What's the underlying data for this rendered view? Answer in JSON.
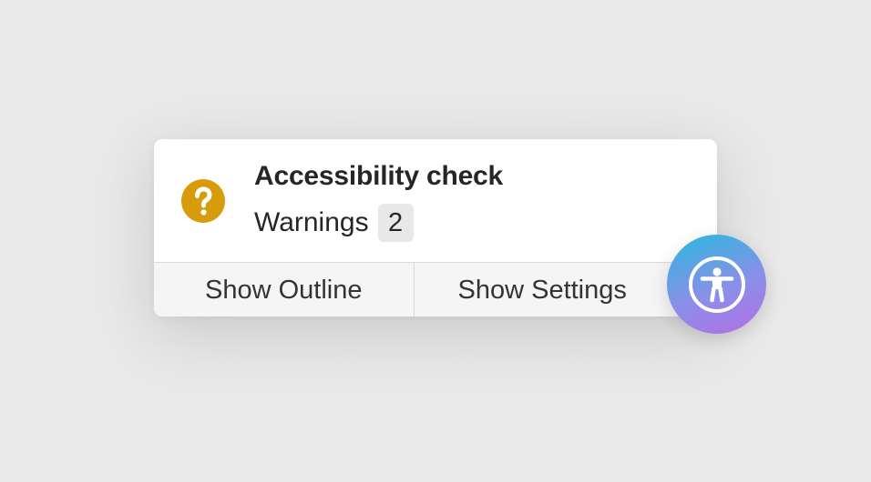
{
  "popover": {
    "icon": "question-mark-icon",
    "title": "Accessibility check",
    "warnings_label": "Warnings",
    "warnings_count": "2",
    "actions": {
      "show_outline": "Show Outline",
      "show_settings": "Show Settings"
    }
  },
  "badge": {
    "icon": "accessibility-icon"
  },
  "colors": {
    "background": "#e9e9ea",
    "warning": "#d69c0b",
    "badge_gradient_start": "#27b9dd",
    "badge_gradient_end": "#b36de6"
  }
}
